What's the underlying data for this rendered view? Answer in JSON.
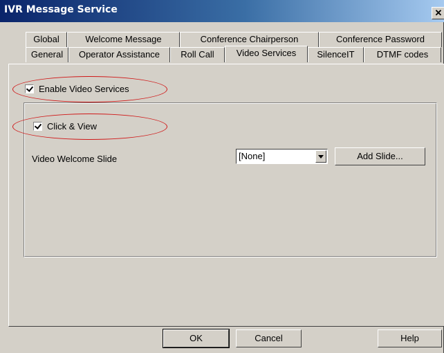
{
  "window": {
    "title": "IVR Message Service",
    "close_glyph": "✕"
  },
  "tabs_back": [
    {
      "label": "Global"
    },
    {
      "label": "Welcome Message"
    },
    {
      "label": "Conference Chairperson"
    },
    {
      "label": "Conference Password"
    }
  ],
  "tabs_front": [
    {
      "label": "General"
    },
    {
      "label": "Operator Assistance"
    },
    {
      "label": "Roll Call"
    },
    {
      "label": "Video Services",
      "active": true
    },
    {
      "label": "SilenceIT"
    },
    {
      "label": "DTMF codes"
    }
  ],
  "video_services": {
    "enable_label": "Enable Video Services",
    "enable_checked": true,
    "click_view_label": "Click & View",
    "click_view_checked": true,
    "welcome_slide_label": "Video Welcome Slide",
    "welcome_slide_value": "[None]",
    "add_slide_label": "Add Slide..."
  },
  "footer": {
    "ok_label": "OK",
    "cancel_label": "Cancel",
    "help_label": "Help"
  },
  "annotation": {
    "color": "#d01818"
  },
  "colors": {
    "titlebar_start": "#0a246a",
    "dialog_bg": "#d4d0c8"
  }
}
